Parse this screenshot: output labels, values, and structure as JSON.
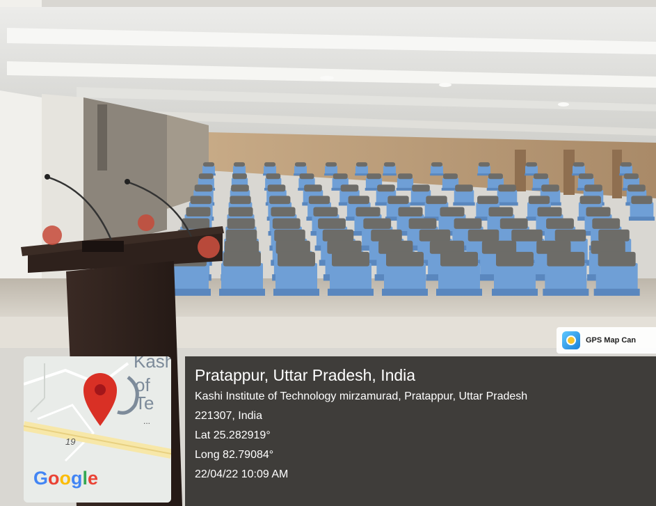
{
  "gps_badge": {
    "app_name": "GPS Map Can",
    "icon": "gps-map-camera-icon"
  },
  "map": {
    "place_label_line1": "Kash",
    "place_label_line2": "of Te",
    "road_number": "19",
    "ellipsis": "...",
    "brand": "Google",
    "marker_icon": "location-pin-icon"
  },
  "location": {
    "place": "Pratappur, Uttar Pradesh, India",
    "address_line1": "Kashi Institute of Technology mirzamurad, Pratappur, Uttar Pradesh",
    "address_line2": "221307, India",
    "lat": "Lat 25.282919°",
    "long": "Long 82.79084°",
    "timestamp": "22/04/22 10:09 AM"
  },
  "colors": {
    "seat_blue": "#6f9fd6",
    "headrest_grey": "#6d6c68",
    "wall_wood": "#b99a78",
    "panel_bg": "#181614",
    "pin_red": "#d93025"
  }
}
